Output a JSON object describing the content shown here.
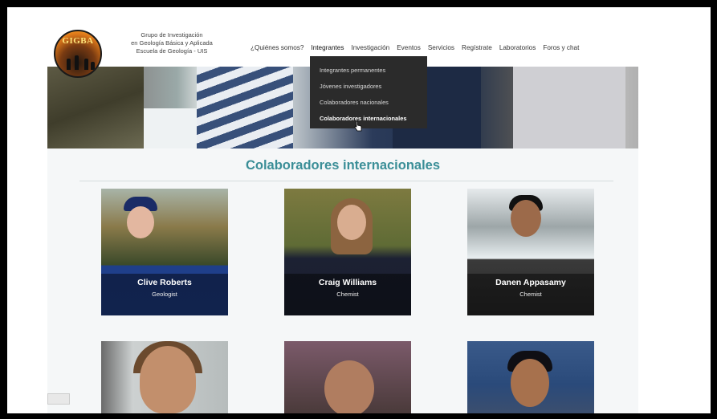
{
  "header": {
    "logo_text": "GIGBA",
    "org_line1": "Grupo de Investigación",
    "org_line2": "en Geología Básica y Aplicada",
    "org_line3": "Escuela de Geología - UIS"
  },
  "nav": {
    "items": [
      "¿Quiénes somos?",
      "Integrantes",
      "Investigación",
      "Eventos",
      "Servicios",
      "Regístrate",
      "Laboratorios",
      "Foros y chat"
    ]
  },
  "dropdown": {
    "items": [
      "Integrantes permanentes",
      "Jóvenes investigadores",
      "Colaboradores nacionales",
      "Colaboradores internacionales"
    ]
  },
  "section": {
    "title": "Colaboradores internacionales"
  },
  "people": [
    {
      "name": "Clive Roberts",
      "role": "Geologist"
    },
    {
      "name": "Craig Williams",
      "role": "Chemist"
    },
    {
      "name": "Danen Appasamy",
      "role": "Chemist"
    }
  ],
  "icons": {
    "cursor": "hand-pointer-icon"
  }
}
